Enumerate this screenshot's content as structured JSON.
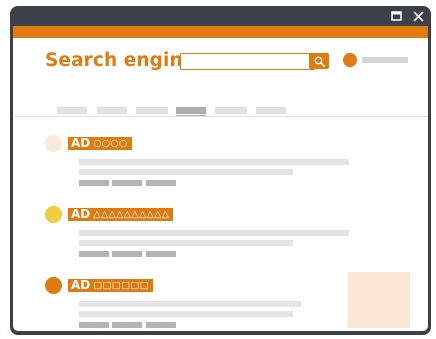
{
  "window": {
    "maximize_icon": "maximize-icon",
    "close_icon": "close-icon"
  },
  "header": {
    "logo_text": "Search engine",
    "search": {
      "value": "",
      "placeholder": ""
    },
    "search_icon": "magnifier-icon"
  },
  "colors": {
    "accent": "#e17b10",
    "frame": "#3c4048",
    "dot_light": "#fde9d9",
    "dot_yellow": "#f2cc3e",
    "thumbnail": "#fbe6d3"
  },
  "results": [
    {
      "ad_label": "AD",
      "title_shapes": "○○○○",
      "dot_color": "#fde9d9"
    },
    {
      "ad_label": "AD",
      "title_shapes": "△△△△△△△△△△",
      "dot_color": "#f2cc3e"
    },
    {
      "ad_label": "AD",
      "title_shapes": "□□□□□□",
      "dot_color": "#e17b10"
    }
  ]
}
